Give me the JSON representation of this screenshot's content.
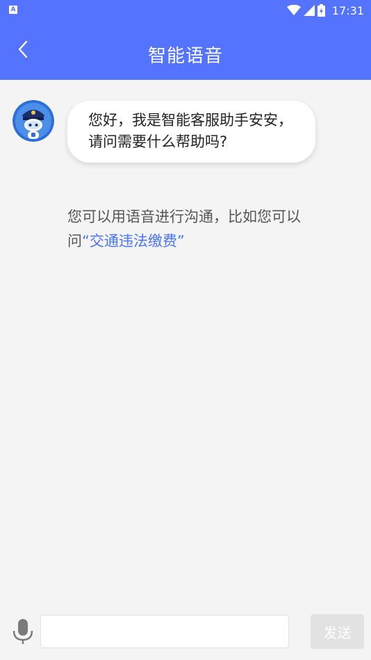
{
  "status_bar": {
    "time": "17:31",
    "left_icon": "A"
  },
  "header": {
    "title": "智能语音",
    "back_icon": "chevron-left-icon"
  },
  "chat": {
    "bot_message": "您好，我是智能客服助手安安，请问需要什么帮助吗?",
    "hint_prefix": "您可以用语音进行沟通，比如您可以问",
    "hint_link": "“交通违法缴费”"
  },
  "input_bar": {
    "placeholder": "",
    "send_label": "发送"
  },
  "colors": {
    "primary": "#5474ff",
    "background": "#f4f4f4",
    "link": "#4a74ff",
    "send_disabled": "#e2e2e2"
  }
}
